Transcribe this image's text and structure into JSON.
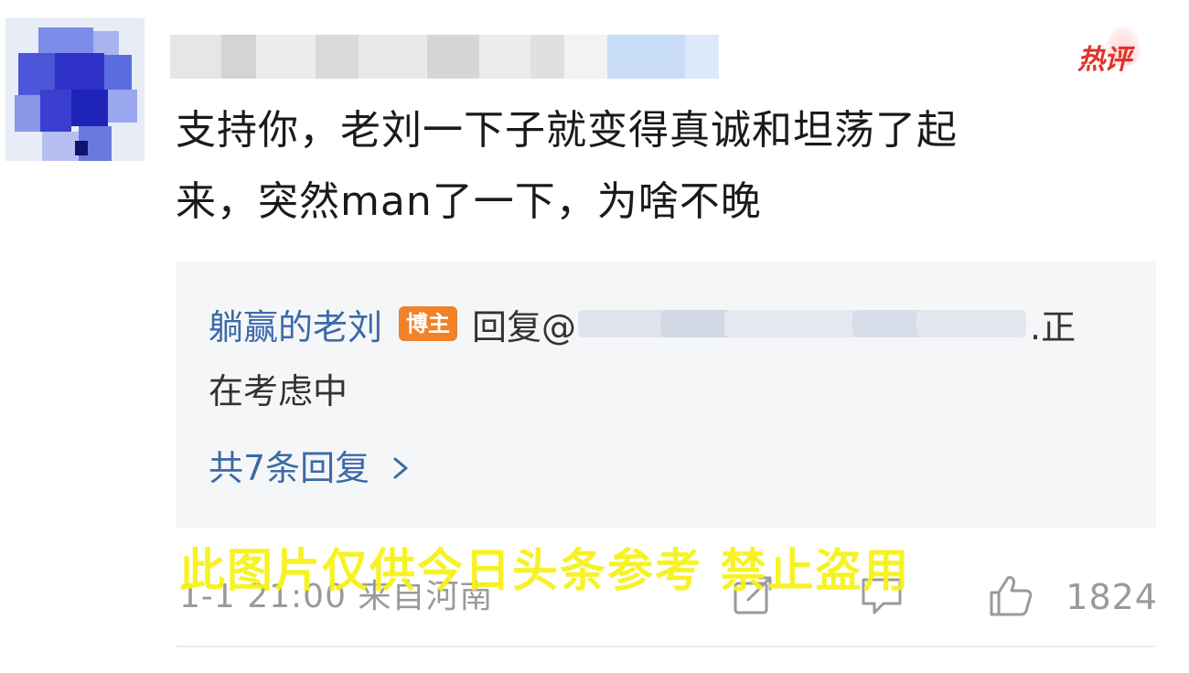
{
  "comment": {
    "hot_badge": "热评",
    "text_line1": "支持你，老刘一下子就变得真诚和坦荡了起",
    "text_line2": "来，突然man了一下，为啥不晚"
  },
  "reply": {
    "author": "躺赢的老刘",
    "badge": "博主",
    "prefix": "回复@",
    "suffix": ".正",
    "text_line2": "在考虑中",
    "more_label": "共7条回复"
  },
  "footer": {
    "meta": "1-1 21:00 来自河南",
    "like_count": "1824"
  },
  "watermark": "此图片仅供今日头条参考 禁止盗用",
  "icons": [
    "share-icon",
    "comment-icon",
    "like-icon",
    "chevron-right-icon"
  ],
  "colors": {
    "link_blue": "#3c6aa8",
    "hot_red": "#e0322d",
    "badge_orange": "#f0822a",
    "watermark_yellow": "#f7f21a",
    "reply_bg": "#f5f6f8"
  }
}
